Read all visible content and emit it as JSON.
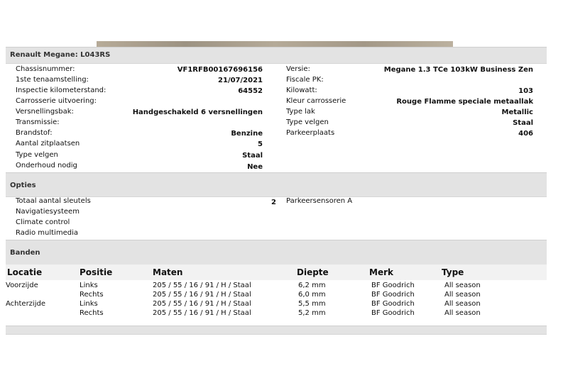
{
  "header": {
    "title": "Renault Megane: L043RS"
  },
  "specs_left": [
    {
      "label": "Chassisnummer:",
      "value": "VF1RFB00167696156"
    },
    {
      "label": "1ste tenaamstelling:",
      "value": "21/07/2021"
    },
    {
      "label": "Inspectie kilometerstand:",
      "value": "64552"
    },
    {
      "label": "Carrosserie uitvoering:",
      "value": ""
    },
    {
      "label": "Versnellingsbak:",
      "value": "Handgeschakeld 6 versnellingen"
    },
    {
      "label": "Transmissie:",
      "value": ""
    },
    {
      "label": "Brandstof:",
      "value": "Benzine"
    },
    {
      "label": "Aantal zitplaatsen",
      "value": "5"
    },
    {
      "label": "Type velgen",
      "value": "Staal"
    },
    {
      "label": "Onderhoud nodig",
      "value": "Nee"
    }
  ],
  "specs_right": [
    {
      "label": "Versie:",
      "value": "Megane 1.3 TCe 103kW Business Zen"
    },
    {
      "label": "Fiscale PK:",
      "value": ""
    },
    {
      "label": "Kilowatt:",
      "value": "103"
    },
    {
      "label": "Kleur carrosserie",
      "value": "Rouge Flamme speciale metaallak"
    },
    {
      "label": "Type lak",
      "value": "Metallic"
    },
    {
      "label": "Type velgen",
      "value": "Staal"
    },
    {
      "label": "Parkeerplaats",
      "value": "406"
    }
  ],
  "options": {
    "title": "Opties",
    "left": [
      {
        "label": "Totaal aantal sleutels",
        "value": "2"
      },
      {
        "label": "Navigatiesysteem"
      },
      {
        "label": "Climate control"
      },
      {
        "label": "Radio multimedia"
      }
    ],
    "right": [
      {
        "label": "Parkeersensoren A"
      }
    ]
  },
  "tires": {
    "title": "Banden",
    "columns": [
      "Locatie",
      "Positie",
      "Maten",
      "Diepte",
      "Merk",
      "Type"
    ],
    "rows": [
      [
        "Voorzijde",
        "Links",
        "205 / 55 / 16 / 91 / H / Staal",
        "6,2 mm",
        "BF Goodrich",
        "All season"
      ],
      [
        "",
        "Rechts",
        "205 / 55 / 16 / 91 / H / Staal",
        "6,0 mm",
        "BF Goodrich",
        "All season"
      ],
      [
        "Achterzijde",
        "Links",
        "205 / 55 / 16 / 91 / H / Staal",
        "5,5 mm",
        "BF Goodrich",
        "All season"
      ],
      [
        "",
        "Rechts",
        "205 / 55 / 16 / 91 / H / Staal",
        "5,2 mm",
        "BF Goodrich",
        "All season"
      ]
    ]
  }
}
